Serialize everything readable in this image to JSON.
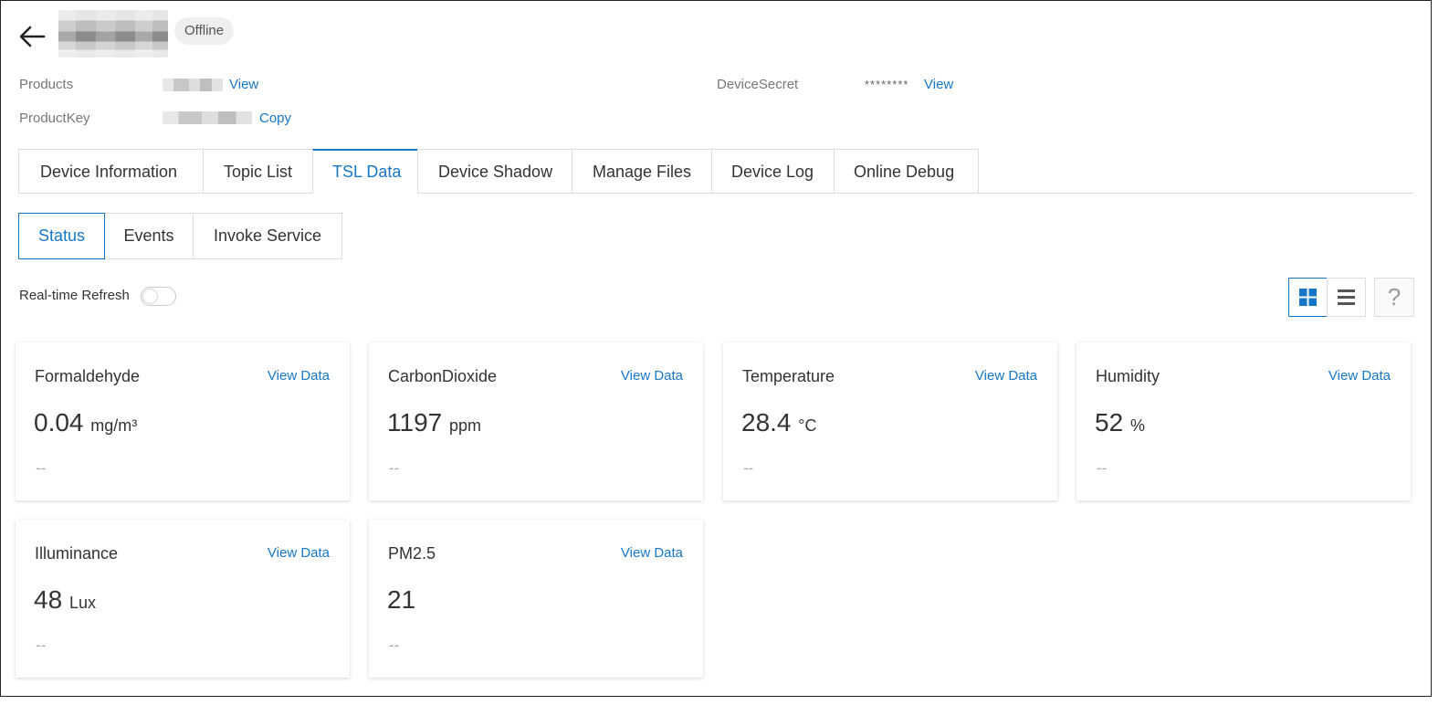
{
  "header": {
    "status_badge": "Offline"
  },
  "meta": {
    "products_label": "Products",
    "products_link": "View",
    "productkey_label": "ProductKey",
    "productkey_link": "Copy",
    "devicesecret_label": "DeviceSecret",
    "devicesecret_value": "********",
    "devicesecret_link": "View"
  },
  "tabs": [
    {
      "label": "Device Information"
    },
    {
      "label": "Topic List"
    },
    {
      "label": "TSL Data",
      "active": true
    },
    {
      "label": "Device Shadow"
    },
    {
      "label": "Manage Files"
    },
    {
      "label": "Device Log"
    },
    {
      "label": "Online Debug"
    }
  ],
  "subtabs": [
    {
      "label": "Status",
      "active": true
    },
    {
      "label": "Events"
    },
    {
      "label": "Invoke Service"
    }
  ],
  "toolbar": {
    "realtime_label": "Real-time Refresh",
    "realtime_on": false,
    "help_icon": "?",
    "active_view": "grid"
  },
  "cards": [
    {
      "name": "Formaldehyde",
      "link": "View Data",
      "value": "0.04",
      "unit": "mg/m³",
      "time": "--"
    },
    {
      "name": "CarbonDioxide",
      "link": "View Data",
      "value": "1197",
      "unit": "ppm",
      "time": "--"
    },
    {
      "name": "Temperature",
      "link": "View Data",
      "value": "28.4",
      "unit": "°C",
      "time": "--"
    },
    {
      "name": "Humidity",
      "link": "View Data",
      "value": "52",
      "unit": "%",
      "time": "--"
    },
    {
      "name": "Illuminance",
      "link": "View Data",
      "value": "48",
      "unit": "Lux",
      "time": "--"
    },
    {
      "name": "PM2.5",
      "link": "View Data",
      "value": "21",
      "unit": "",
      "time": "--"
    }
  ],
  "colors": {
    "accent": "#1677c8",
    "border": "#dddddd",
    "muted_text": "#777777"
  }
}
